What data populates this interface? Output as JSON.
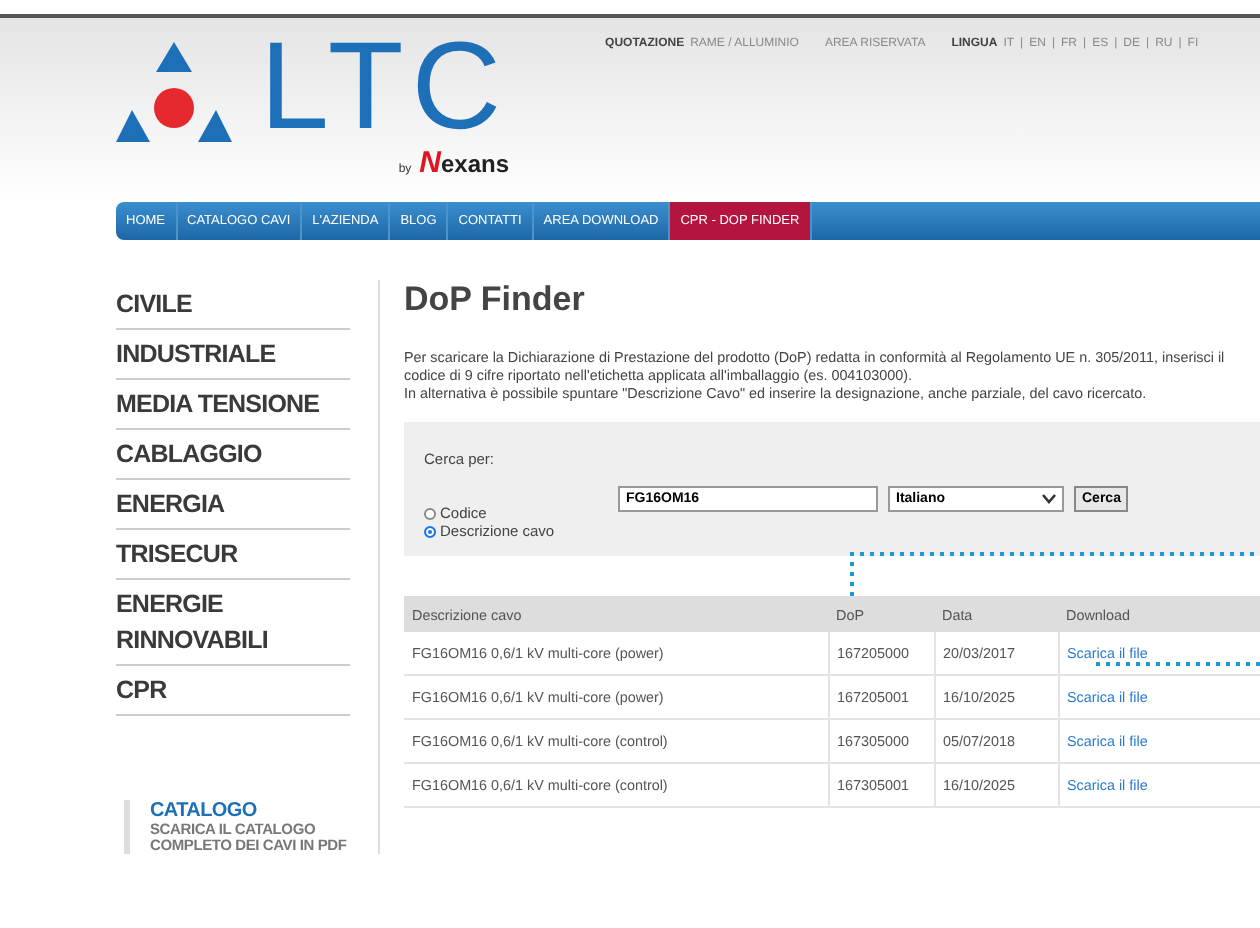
{
  "top_bar": {
    "quote_label": "QUOTAZIONE",
    "quote_link": "RAME / ALLUMINIO",
    "reserved_area": "AREA RISERVATA",
    "language_label": "LINGUA",
    "separator": "|",
    "languages": [
      "IT",
      "EN",
      "FR",
      "ES",
      "DE",
      "RU",
      "FI"
    ]
  },
  "logo": {
    "name": "LTC",
    "by": "by",
    "brand_initial": "N",
    "brand_rest": "exans"
  },
  "nav": [
    {
      "label": "HOME",
      "selected": false
    },
    {
      "label": "CATALOGO CAVI",
      "selected": false
    },
    {
      "label": "L'AZIENDA",
      "selected": false
    },
    {
      "label": "BLOG",
      "selected": false
    },
    {
      "label": "CONTATTI",
      "selected": false
    },
    {
      "label": "AREA DOWNLOAD",
      "selected": false
    },
    {
      "label": "CPR - DOP FINDER",
      "selected": true
    }
  ],
  "sidebar": {
    "items": [
      "CIVILE",
      "INDUSTRIALE",
      "MEDIA TENSIONE",
      "CABLAGGIO",
      "ENERGIA",
      "TRISECUR",
      "ENERGIE RINNOVABILI",
      "CPR"
    ],
    "catalog": {
      "title": "CATALOGO",
      "text": "SCARICA IL CATALOGO COMPLETO DEI CAVI IN PDF"
    }
  },
  "main": {
    "title": "DoP Finder",
    "intro": [
      "Per scaricare la Dichiarazione di Prestazione del prodotto (DoP) redatta in conformità al Regolamento UE n. 305/2011, inserisci il codice di 9 cifre riportato nell'etichetta applicata all'imballaggio (es. 004103000).",
      "In alternativa è possibile spuntare \"Descrizione Cavo\" ed inserire la designazione, anche parziale, del cavo ricercato."
    ],
    "search": {
      "label": "Cerca per:",
      "options": [
        {
          "label": "Codice",
          "selected": false
        },
        {
          "label": "Descrizione cavo",
          "selected": true
        }
      ],
      "value": "FG16OM16",
      "language": "Italiano",
      "button": "Cerca"
    },
    "table": {
      "columns": [
        "Descrizione cavo",
        "DoP",
        "Data",
        "Download"
      ],
      "rows": [
        {
          "description": "FG16OM16 0,6/1 kV multi-core (power)",
          "dop": "167205000",
          "date": "20/03/2017",
          "link": "Scarica il file"
        },
        {
          "description": "FG16OM16 0,6/1 kV multi-core (power)",
          "dop": "167205001",
          "date": "16/10/2025",
          "link": "Scarica il file"
        },
        {
          "description": "FG16OM16 0,6/1 kV multi-core (control)",
          "dop": "167305000",
          "date": "05/07/2018",
          "link": "Scarica il file"
        },
        {
          "description": "FG16OM16 0,6/1 kV multi-core (control)",
          "dop": "167305001",
          "date": "16/10/2025",
          "link": "Scarica il file"
        }
      ]
    }
  }
}
